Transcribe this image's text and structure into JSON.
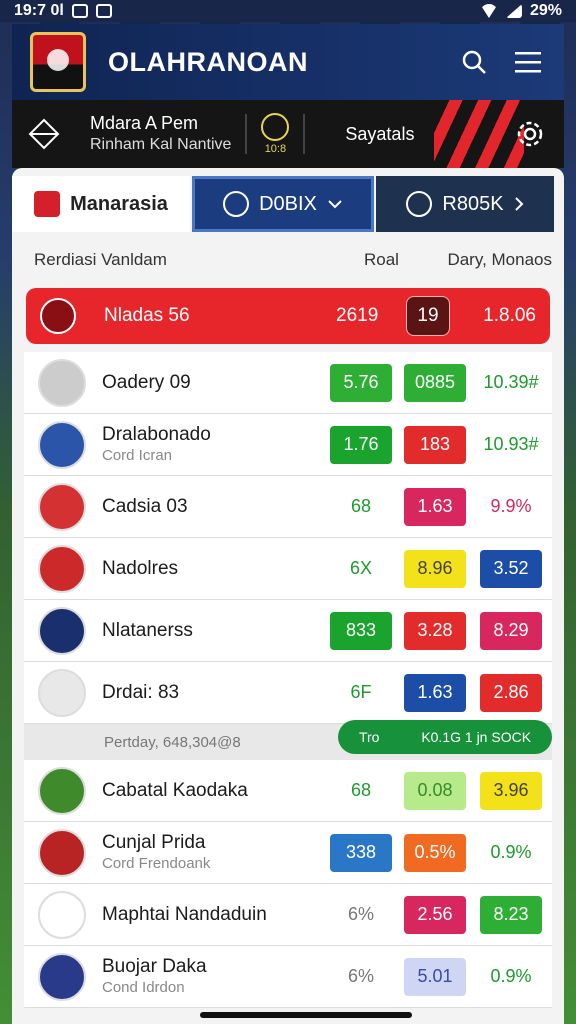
{
  "statusbar": {
    "time": "19:7 0l",
    "battery": "29%"
  },
  "appbar": {
    "title": "OLAHRANOAN"
  },
  "promo": {
    "title": "Mdara A Pem",
    "subtitle": "Rinham Kal Nantive",
    "badge": "10:8",
    "settings_label": "Sayatals"
  },
  "tabs": [
    {
      "label": "Manarasia",
      "icon": "flag-icon"
    },
    {
      "label": "D0BIX",
      "icon": "globe-icon"
    },
    {
      "label": "R805K",
      "icon": "ball-icon"
    }
  ],
  "columns": {
    "name": "Rerdiasi Vanldam",
    "rank": "Roal",
    "daily": "Dary, Monaos"
  },
  "featured": {
    "name": "Nladas 56",
    "v1": "2619",
    "v2": "19",
    "v3": "1.8.06"
  },
  "rows": [
    {
      "name": "Oadery 09",
      "sub": "",
      "a": "5.76",
      "b": "0885",
      "c": "10.39#",
      "colors": [
        "#2fae35",
        "#2fae35",
        "transparent"
      ],
      "text": [
        "#fff",
        "#fff",
        "#1e9a2e"
      ],
      "avatar": "#ccc"
    },
    {
      "name": "Dralabonado",
      "sub": "Cord Icran",
      "a": "1.76",
      "b": "183",
      "c": "10.93#",
      "colors": [
        "#1aa32d",
        "#e22b2b",
        "transparent"
      ],
      "text": [
        "#fff",
        "#fff",
        "#1e9a2e"
      ],
      "avatar": "#2a55a8"
    },
    {
      "name": "Cadsia 03",
      "sub": "",
      "a": "68",
      "b": "1.63",
      "c": "9.9%",
      "colors": [
        "transparent",
        "#d8265e",
        "transparent"
      ],
      "text": [
        "#1e9a2e",
        "#fff",
        "#d8265e"
      ],
      "avatar": "#d43232"
    },
    {
      "name": "Nadolres",
      "sub": "",
      "a": "6X",
      "b": "8.96",
      "c": "3.52",
      "colors": [
        "transparent",
        "#f3e21a",
        "#1c4ea8"
      ],
      "text": [
        "#1e9a2e",
        "#444",
        "#fff"
      ],
      "avatar": "#cc2a2a"
    },
    {
      "name": "Nlatanerss",
      "sub": "",
      "a": "833",
      "b": "3.28",
      "c": "8.29",
      "colors": [
        "#1aa32d",
        "#e22b2b",
        "#d8265e"
      ],
      "text": [
        "#fff",
        "#fff",
        "#fff"
      ],
      "avatar": "#1a2f6e"
    },
    {
      "name": "Drdai: 83",
      "sub": "",
      "a": "6F",
      "b": "1.63",
      "c": "2.86",
      "colors": [
        "transparent",
        "#1c4ea8",
        "#e22b2b"
      ],
      "text": [
        "#1e9a2e",
        "#fff",
        "#fff"
      ],
      "avatar": "#e8e8e8"
    }
  ],
  "strip": {
    "label": "Pertday, 648,304@8",
    "pill_left": "Tro",
    "pill_right": "K0.1G 1 jn SOCK"
  },
  "rows2": [
    {
      "name": "Cabatal Kaodaka",
      "sub": "",
      "a": "68",
      "b": "0.08",
      "c": "3.96",
      "colors": [
        "transparent",
        "#b6ea8a",
        "#f3e21a"
      ],
      "text": [
        "#1e9a2e",
        "#3a8a2a",
        "#444"
      ],
      "avatar": "#3f8a2a"
    },
    {
      "name": "Cunjal Prida",
      "sub": "Cord Frendoank",
      "a": "338",
      "b": "0.5%",
      "c": "0.9%",
      "colors": [
        "#2a77c8",
        "#f06a22",
        "transparent"
      ],
      "text": [
        "#fff",
        "#fff",
        "#1e9a2e"
      ],
      "avatar": "#b82323"
    },
    {
      "name": "Maphtai Nandaduin",
      "sub": "",
      "a": "6%",
      "b": "2.56",
      "c": "8.23",
      "colors": [
        "transparent",
        "#d8265e",
        "#2fae35"
      ],
      "text": [
        "#777",
        "#fff",
        "#fff"
      ],
      "avatar": "#fff"
    },
    {
      "name": "Buojar Daka",
      "sub": "Cond Idrdon",
      "a": "6%",
      "b": "5.01",
      "c": "0.9%",
      "colors": [
        "transparent",
        "#cfd6f4",
        "transparent"
      ],
      "text": [
        "#777",
        "#3a4aa8",
        "#1e9a2e"
      ],
      "avatar": "#2a3a8a"
    }
  ]
}
